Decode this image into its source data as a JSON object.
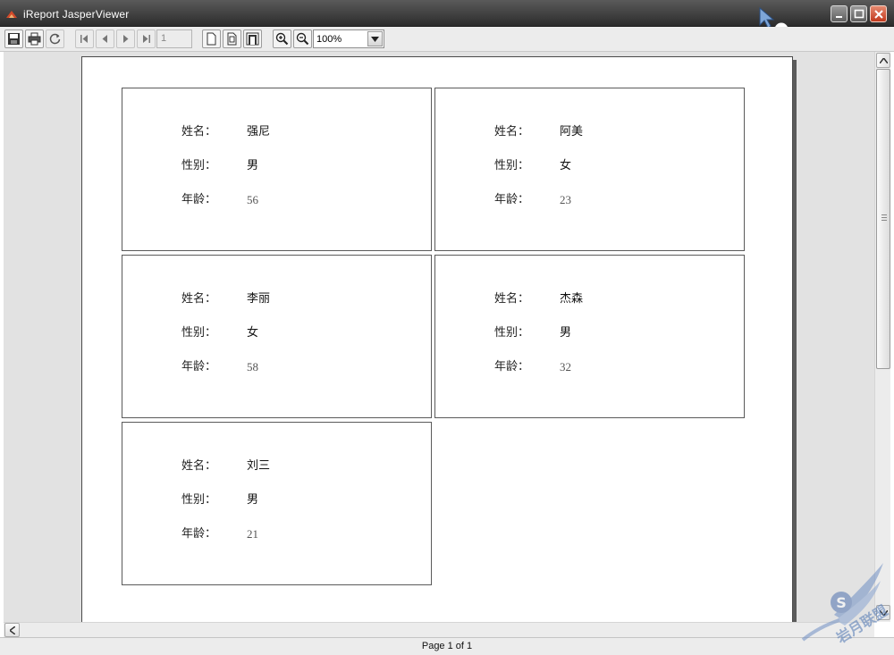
{
  "window": {
    "title": "iReport JasperViewer",
    "colors": {
      "titlebar": "#3c3c3c",
      "close": "#c2391d"
    }
  },
  "toolbar": {
    "buttons": [
      {
        "icon": "save-icon"
      },
      {
        "icon": "print-icon"
      },
      {
        "icon": "reload-icon"
      },
      {
        "icon": "first-page-icon"
      },
      {
        "icon": "previous-page-icon"
      },
      {
        "icon": "next-page-icon"
      },
      {
        "icon": "last-page-icon"
      },
      {
        "icon": "actual-size-icon"
      },
      {
        "icon": "fit-page-icon"
      },
      {
        "icon": "fit-width-icon"
      },
      {
        "icon": "zoom-in-icon"
      },
      {
        "icon": "zoom-out-icon"
      }
    ],
    "page_number": "1",
    "zoom": "100%"
  },
  "report": {
    "labels": {
      "name": "姓名：",
      "gender": "性别：",
      "age": "年龄："
    },
    "records": [
      {
        "name": "强尼",
        "gender": "男",
        "age": "56"
      },
      {
        "name": "阿美",
        "gender": "女",
        "age": "23"
      },
      {
        "name": "李丽",
        "gender": "女",
        "age": "58"
      },
      {
        "name": "杰森",
        "gender": "男",
        "age": "32"
      },
      {
        "name": "刘三",
        "gender": "男",
        "age": "21"
      }
    ]
  },
  "status": {
    "text": "Page 1 of 1"
  },
  "watermark": {
    "text": "岩月联盟",
    "icon": "winged-s-logo-icon"
  }
}
